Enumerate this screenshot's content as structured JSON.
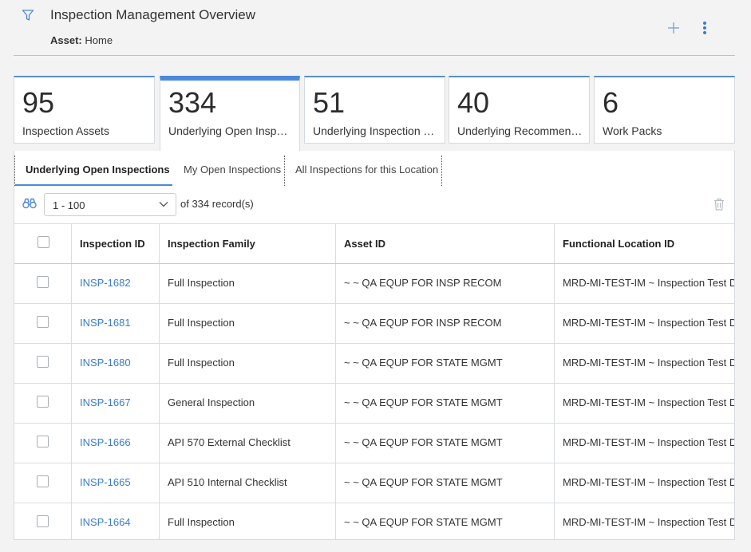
{
  "header": {
    "title": "Inspection Management Overview",
    "asset_key": "Asset:",
    "asset_value": "Home"
  },
  "colors": {
    "accent": "#4c89d9",
    "link": "#3a7ccc"
  },
  "cards": [
    {
      "value": "95",
      "label": "Inspection Assets"
    },
    {
      "value": "334",
      "label": "Underlying Open Inspect..."
    },
    {
      "value": "51",
      "label": "Underlying Inspection Ta..."
    },
    {
      "value": "40",
      "label": "Underlying Recommend..."
    },
    {
      "value": "6",
      "label": "Work Packs"
    }
  ],
  "tabs": [
    {
      "label": "Underlying Open Inspections"
    },
    {
      "label": "My Open Inspections"
    },
    {
      "label": "All Inspections for this Location"
    }
  ],
  "toolbar": {
    "range_value": "1 - 100",
    "record_text": "of  334  record(s)"
  },
  "grid": {
    "headers": {
      "id": "Inspection ID",
      "family": "Inspection Family",
      "asset": "Asset ID",
      "floc": "Functional Location ID"
    },
    "rows": [
      {
        "id": "INSP-1682",
        "family": "Full Inspection",
        "asset": "~ ~ QA EQUP FOR INSP RECOM",
        "floc": "MRD-MI-TEST-IM ~ Inspection Test Data"
      },
      {
        "id": "INSP-1681",
        "family": "Full Inspection",
        "asset": "~ ~ QA EQUP FOR INSP RECOM",
        "floc": "MRD-MI-TEST-IM ~ Inspection Test Data"
      },
      {
        "id": "INSP-1680",
        "family": "Full Inspection",
        "asset": "~ ~ QA EQUP FOR STATE MGMT",
        "floc": "MRD-MI-TEST-IM ~ Inspection Test Data"
      },
      {
        "id": "INSP-1667",
        "family": "General Inspection",
        "asset": "~ ~ QA EQUP FOR STATE MGMT",
        "floc": "MRD-MI-TEST-IM ~ Inspection Test Data"
      },
      {
        "id": "INSP-1666",
        "family": "API 570 External Checklist",
        "asset": "~ ~ QA EQUP FOR STATE MGMT",
        "floc": "MRD-MI-TEST-IM ~ Inspection Test Data"
      },
      {
        "id": "INSP-1665",
        "family": "API 510 Internal Checklist",
        "asset": "~ ~ QA EQUP FOR STATE MGMT",
        "floc": "MRD-MI-TEST-IM ~ Inspection Test Data"
      },
      {
        "id": "INSP-1664",
        "family": "Full Inspection",
        "asset": "~ ~ QA EQUP FOR STATE MGMT",
        "floc": "MRD-MI-TEST-IM ~ Inspection Test Data"
      }
    ]
  }
}
